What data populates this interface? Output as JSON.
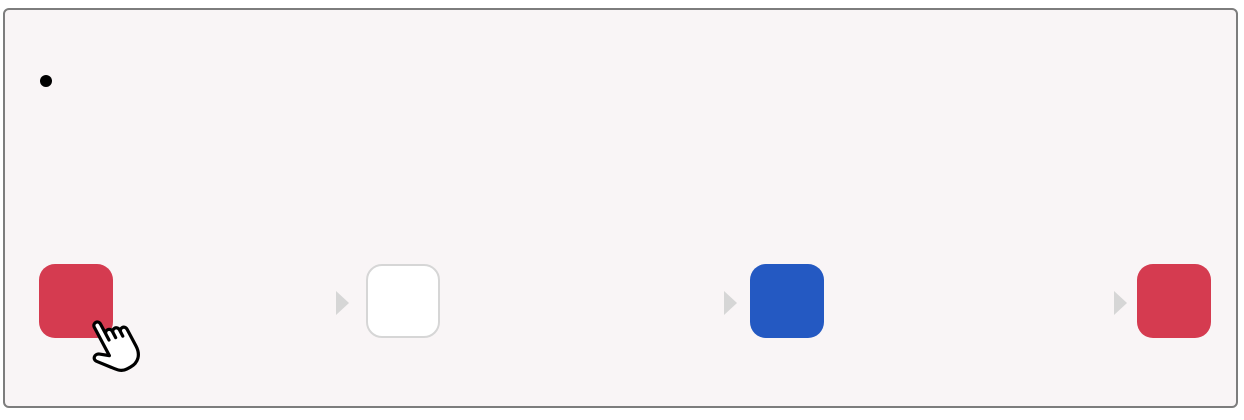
{
  "swatches": [
    {
      "name": "swatch-1",
      "color": "#d53b50"
    },
    {
      "name": "swatch-2",
      "color": "#ffffff"
    },
    {
      "name": "swatch-3",
      "color": "#2459c2"
    },
    {
      "name": "swatch-4",
      "color": "#d53b50"
    }
  ],
  "cursor": {
    "icon": "hand-pointer-icon"
  },
  "colors": {
    "panel_background": "#f9f5f6",
    "panel_border": "#7d7d7d",
    "arrow": "#d6d6d6"
  }
}
